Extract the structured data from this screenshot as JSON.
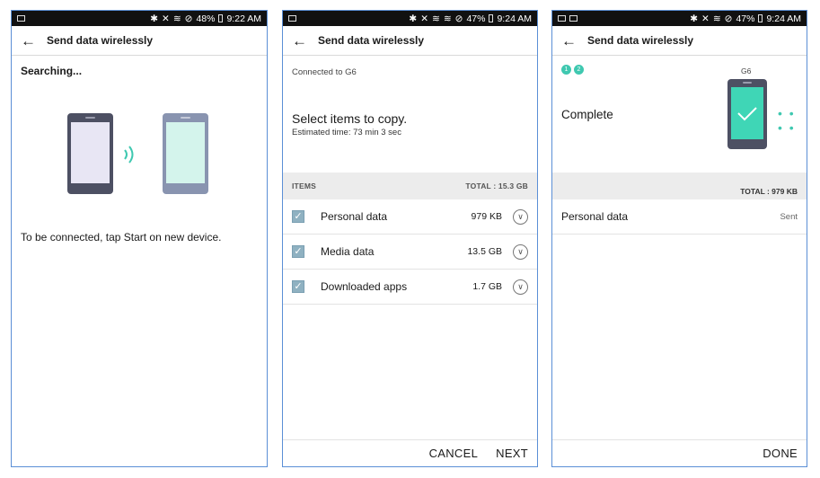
{
  "screen1": {
    "status": {
      "battery": "48%",
      "time": "9:22 AM"
    },
    "title": "Send data wirelessly",
    "searching": "Searching...",
    "message": "To be connected, tap Start on new device."
  },
  "screen2": {
    "status": {
      "battery": "47%",
      "time": "9:24 AM"
    },
    "title": "Send data wirelessly",
    "connected": "Connected to G6",
    "select_title": "Select items to copy.",
    "estimated": "Estimated time: 73 min 3 sec",
    "items_header": "ITEMS",
    "total": "TOTAL : 15.3 GB",
    "items": [
      {
        "label": "Personal data",
        "size": "979 KB",
        "checked": true
      },
      {
        "label": "Media data",
        "size": "13.5 GB",
        "checked": true
      },
      {
        "label": "Downloaded apps",
        "size": "1.7 GB",
        "checked": true
      }
    ],
    "cancel": "CANCEL",
    "next": "NEXT"
  },
  "screen3": {
    "status": {
      "battery": "47%",
      "time": "9:24 AM"
    },
    "title": "Send data wirelessly",
    "steps": [
      "1",
      "2"
    ],
    "device": "G6",
    "complete": "Complete",
    "dots": "• • • •",
    "total": "TOTAL : 979 KB",
    "row_label": "Personal data",
    "row_status": "Sent",
    "done": "DONE"
  },
  "colors": {
    "accent": "#3fc8b0",
    "frame": "#5b8fd6",
    "checkbox": "#8fb1c1"
  }
}
